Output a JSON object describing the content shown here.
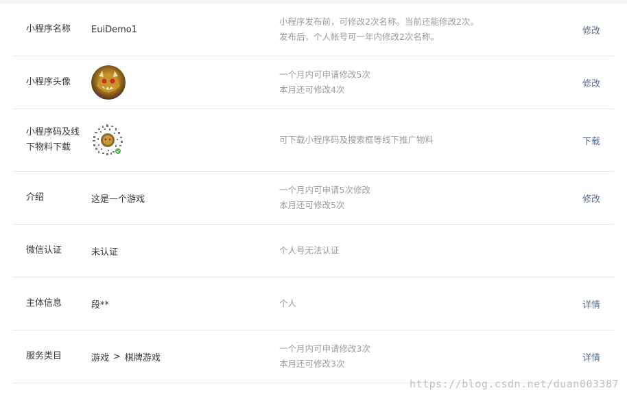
{
  "rows": [
    {
      "label": "小程序名称",
      "value": "EuiDemo1",
      "desc": [
        "小程序发布前，可修改2次名称。当前还能修改2次。",
        "发布后，个人帐号可一年内修改2次名称。"
      ],
      "action": "修改"
    },
    {
      "label": "小程序头像",
      "value_icon": "avatar-image",
      "desc": [
        "一个月内可申请修改5次",
        "本月还可修改4次"
      ],
      "action": "修改"
    },
    {
      "label": "小程序码及线下物料下载",
      "value_icon": "mini-program-code",
      "desc": [
        "可下载小程序码及搜索框等线下推广物料"
      ],
      "action": "下载"
    },
    {
      "label": "介绍",
      "value": "这是一个游戏",
      "desc": [
        "一个月内可申请5次修改",
        "本月还可修改5次"
      ],
      "action": "修改"
    },
    {
      "label": "微信认证",
      "value": "未认证",
      "desc": [
        "个人号无法认证"
      ],
      "action": ""
    },
    {
      "label": "主体信息",
      "value": "段**",
      "desc": [
        "个人"
      ],
      "action": "详情"
    },
    {
      "label": "服务类目",
      "value_category": "游戏",
      "value_separator": ">",
      "value_subcategory": "棋牌游戏",
      "desc": [
        "一个月内可申请修改3次",
        "本月还可修改3次"
      ],
      "action": "详情"
    }
  ],
  "watermark": "https://blog.csdn.net/duan003387",
  "colors": {
    "link": "#576b95",
    "label": "#353535",
    "desc": "#9a9a9a",
    "divider": "#e7e7eb"
  }
}
